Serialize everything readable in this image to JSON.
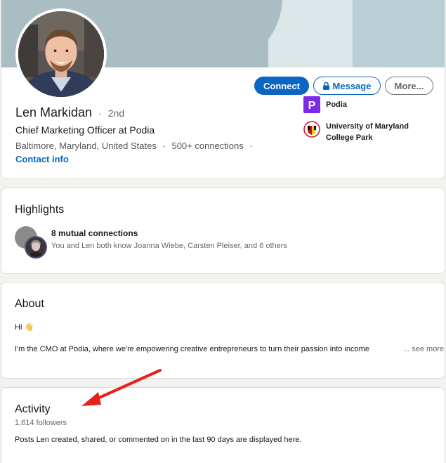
{
  "profile": {
    "name": "Len Markidan",
    "degree_separator": "·",
    "degree": "2nd",
    "headline": "Chief Marketing Officer at Podia",
    "location": "Baltimore, Maryland, United States",
    "location_separator": "·",
    "connections": "500+ connections",
    "trailing_separator": "·",
    "contact_info_label": "Contact info"
  },
  "actions": {
    "connect_label": "Connect",
    "message_label": "Message",
    "more_label": "More..."
  },
  "organizations": [
    {
      "name": "Podia",
      "logo_letter": "P",
      "icon": "podia-logo",
      "color": "#7d2ae8"
    },
    {
      "name": "University of Maryland College Park",
      "icon": "umd-seal-logo"
    }
  ],
  "highlights": {
    "title": "Highlights",
    "mutual_title": "8 mutual connections",
    "mutual_description": "You and Len both know Joanna Wiebe, Carsten Pleiser, and 6 others"
  },
  "about": {
    "title": "About",
    "greeting": "Hi 👋",
    "text": "I'm the CMO at Podia, where we're empowering creative entrepreneurs to turn their passion into income",
    "ellipsis": "...",
    "see_more_label": "see more"
  },
  "activity": {
    "title": "Activity",
    "followers": "1,614 followers",
    "description": "Posts Len created, shared, or commented on in the last 90 days are displayed here."
  },
  "colors": {
    "primary": "#0a66c2",
    "annotation_arrow": "#e8201c",
    "banner": "#a9bdc2"
  }
}
